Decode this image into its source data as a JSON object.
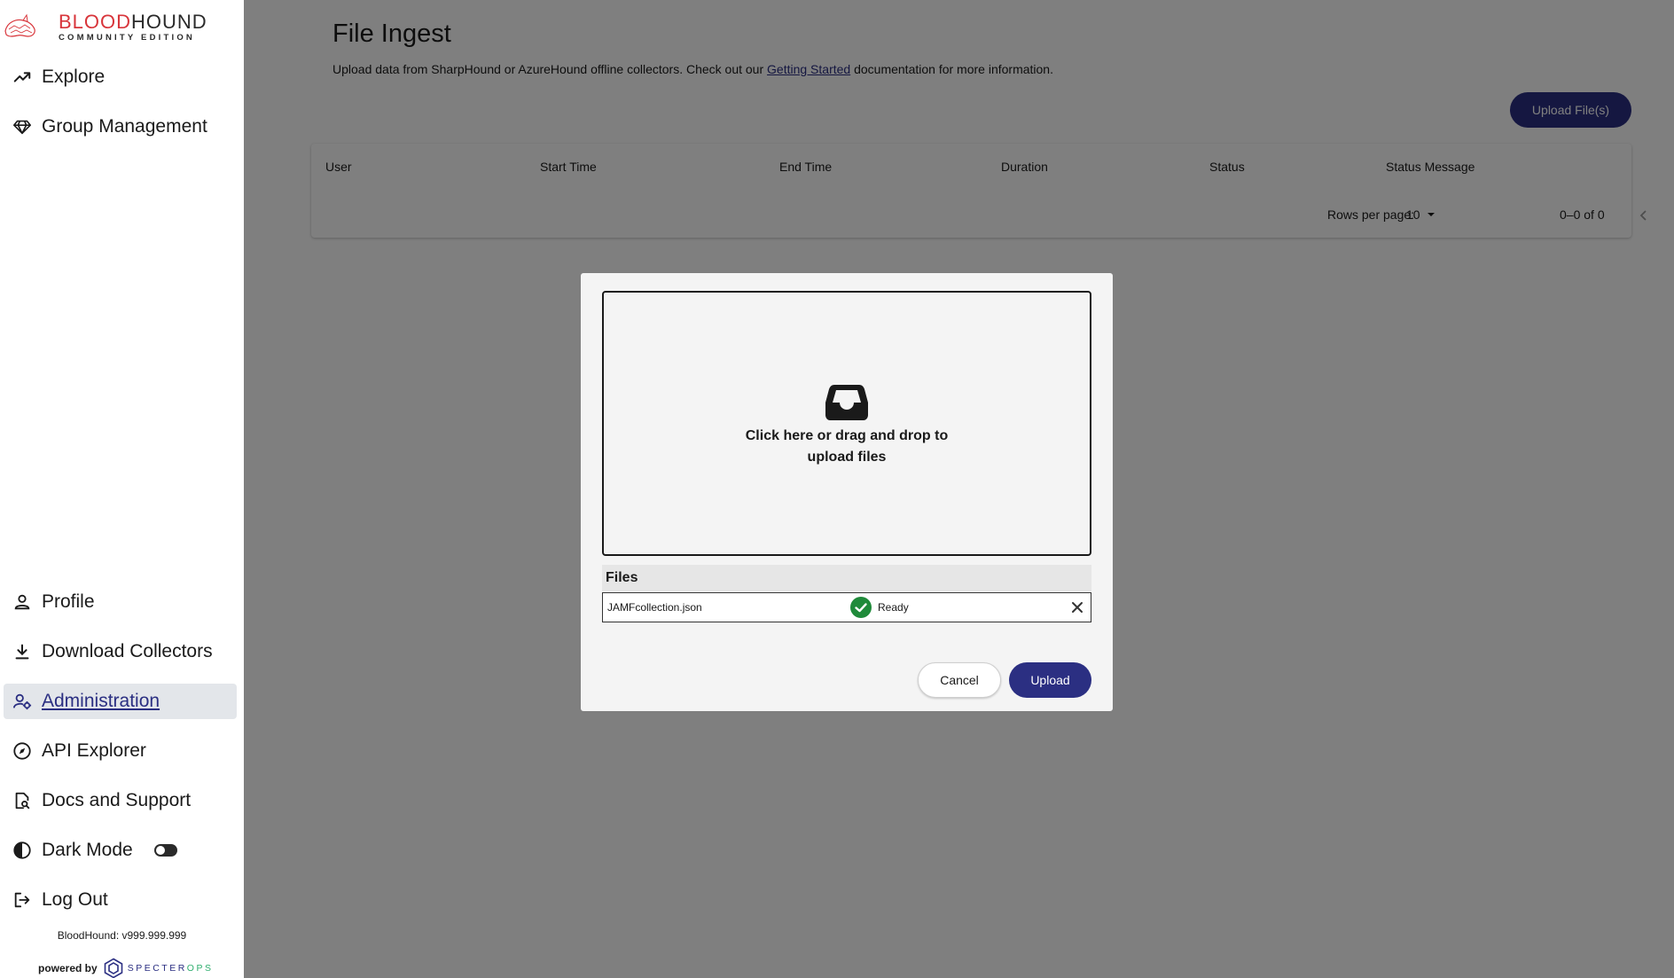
{
  "brand": {
    "name_red": "BLOOD",
    "name_dark": "HOUND",
    "subtitle": "COMMUNITY EDITION"
  },
  "sidebar": {
    "top_items": [
      {
        "label": "Explore",
        "icon": "trend-line-icon"
      },
      {
        "label": "Group Management",
        "icon": "gem-icon"
      }
    ],
    "bottom_items": [
      {
        "label": "Profile",
        "icon": "person-icon"
      },
      {
        "label": "Download Collectors",
        "icon": "download-icon"
      },
      {
        "label": "Administration",
        "icon": "admin-gear-icon",
        "active": true
      },
      {
        "label": "API Explorer",
        "icon": "compass-icon"
      },
      {
        "label": "Docs and Support",
        "icon": "doc-search-icon"
      },
      {
        "label": "Dark Mode",
        "icon": "contrast-icon",
        "toggle": false
      },
      {
        "label": "Log Out",
        "icon": "logout-icon"
      }
    ],
    "version": "BloodHound: v999.999.999",
    "powered_by": "powered by",
    "specterops_a": "SPECTER",
    "specterops_b": "OPS"
  },
  "main": {
    "title": "File Ingest",
    "desc_pre": "Upload data from SharpHound or AzureHound offline collectors. Check out our ",
    "desc_link": "Getting Started",
    "desc_post": " documentation for more information.",
    "upload_button": "Upload File(s)",
    "table": {
      "columns": [
        "User",
        "Start Time",
        "End Time",
        "Duration",
        "Status",
        "Status Message"
      ],
      "rows_per_page_label": "Rows per page:",
      "rows_per_page_value": "10",
      "range": "0–0 of 0"
    }
  },
  "dialog": {
    "dropzone_text_1": "Click here or drag and drop to",
    "dropzone_text_2": "upload files",
    "files_header": "Files",
    "files": [
      {
        "name": "JAMFcollection.json",
        "status": "Ready"
      }
    ],
    "cancel": "Cancel",
    "upload": "Upload"
  },
  "colors": {
    "accent": "#2b2f82",
    "brand_red": "#d8353b",
    "success": "#1f8a3a"
  }
}
